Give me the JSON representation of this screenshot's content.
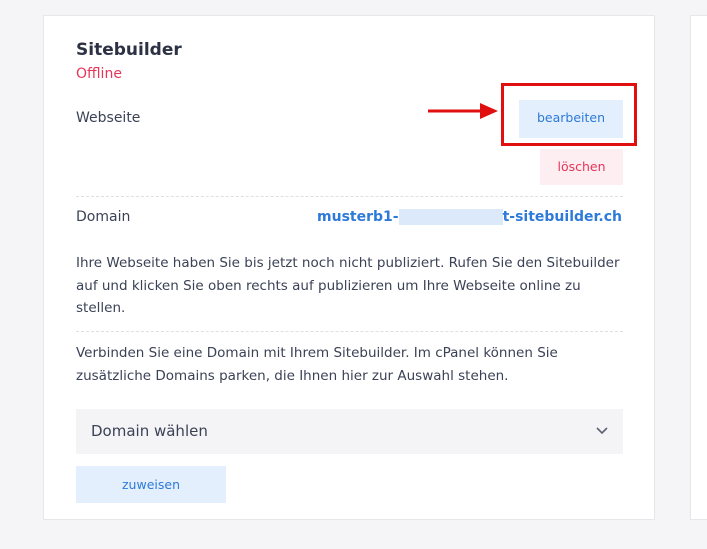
{
  "card": {
    "title": "Sitebuilder",
    "status": "Offline",
    "website_label": "Webseite",
    "edit_label": "bearbeiten",
    "delete_label": "löschen",
    "domain_label": "Domain",
    "domain_value_start": "musterb1-",
    "domain_value_end": "t-sitebuilder.ch",
    "info_text": "Ihre Webseite haben Sie bis jetzt noch nicht publiziert. Rufen Sie den Sitebuilder auf und klicken Sie oben rechts auf publizieren um Ihre Webseite online zu stellen.",
    "connect_text": "Verbinden Sie eine Domain mit Ihrem Sitebuilder. Im cPanel können Sie zusätzliche Domains parken, die Ihnen hier zur Auswahl stehen.",
    "select_placeholder": "Domain wählen",
    "assign_label": "zuweisen"
  },
  "colors": {
    "accent": "#2d7ad9",
    "danger": "#e8345a",
    "annotation": "#e01010"
  },
  "icons": {
    "chevron": "chevron-down-icon",
    "arrow": "arrow-right-icon"
  }
}
